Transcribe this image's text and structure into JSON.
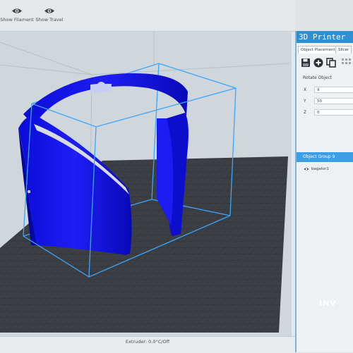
{
  "toolbar": {
    "show_filament": {
      "label": "Show Filament",
      "icon": "eye-icon"
    },
    "show_travel": {
      "label": "Show Travel",
      "icon": "eye-icon"
    }
  },
  "side_panel": {
    "title": "3D Printer",
    "tabs": [
      {
        "label": "Object Placement",
        "active": true
      },
      {
        "label": "Slicer",
        "active": false
      }
    ],
    "icons": [
      "save-icon",
      "add-icon",
      "copy-icon",
      "grid-icon"
    ],
    "rotate_label": "Rotate Object",
    "position": [
      {
        "axis": "X",
        "value": "9"
      },
      {
        "axis": "Y",
        "value": "50"
      },
      {
        "axis": "Z",
        "value": "0"
      }
    ],
    "group_label": "Object Group 9",
    "item_label": "bagator1",
    "brand_mark": "INV"
  },
  "status": {
    "text": "Extruder: 0.0°C/Off"
  },
  "colors": {
    "accent": "#2f8fd1",
    "model": "#1414f0",
    "bounding_box": "#3aa6ff",
    "bed": "#3c3f44"
  }
}
